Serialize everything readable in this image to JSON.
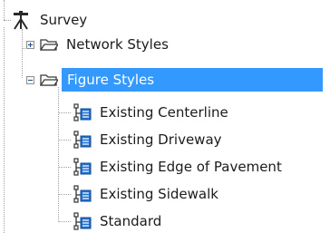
{
  "tree": {
    "root": {
      "label": "Survey",
      "icon": "survey-icon",
      "expanded": true
    },
    "children": [
      {
        "label": "Network Styles",
        "icon": "folder-icon",
        "expanded": false
      },
      {
        "label": "Figure Styles",
        "icon": "folder-icon",
        "expanded": true,
        "selected": true,
        "children": [
          {
            "label": "Existing Centerline",
            "icon": "figure-style-icon"
          },
          {
            "label": "Existing Driveway",
            "icon": "figure-style-icon"
          },
          {
            "label": "Existing Edge of Pavement",
            "icon": "figure-style-icon"
          },
          {
            "label": "Existing Sidewalk",
            "icon": "figure-style-icon"
          },
          {
            "label": "Standard",
            "icon": "figure-style-icon"
          }
        ]
      }
    ]
  },
  "colors": {
    "selection": "#3399ff",
    "connector": "#a0a0a0",
    "text": "#1b1b1b"
  }
}
